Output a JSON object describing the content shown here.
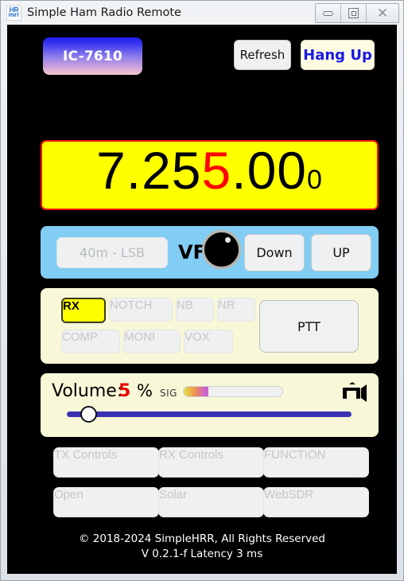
{
  "window": {
    "title": "Simple Ham Radio Remote",
    "icon_line1": "HR",
    "icon_line2": "RMT",
    "minimize_label": "",
    "maximize_label": "",
    "close_label": "✕"
  },
  "header": {
    "radio_model": "IC-7610",
    "refresh_label": "Refresh",
    "hangup_label": "Hang Up"
  },
  "frequency": {
    "part_black_1": "7.25",
    "part_red": "5",
    "part_black_2": ".00",
    "part_small": "0",
    "full_value": "7.255000",
    "bg_color": "#ffff00",
    "border_color": "#ff1010",
    "digit_color": "#000000",
    "highlight_color": "#ff0000"
  },
  "vfo": {
    "band_mode_label": "40m - LSB",
    "vfo_label": "VFO",
    "down_label": "Down",
    "up_label": "UP",
    "panel_color": "#82cdf4"
  },
  "controls": {
    "row1": [
      {
        "label": "RX",
        "state": "active"
      },
      {
        "label": "NOTCH",
        "state": "disabled"
      },
      {
        "label": "NB",
        "state": "disabled"
      },
      {
        "label": "NR",
        "state": "disabled"
      }
    ],
    "row2": [
      {
        "label": "COMP",
        "state": "disabled"
      },
      {
        "label": "MONI",
        "state": "disabled"
      },
      {
        "label": "VOX",
        "state": "disabled"
      }
    ],
    "ptt_label": "PTT",
    "panel_color": "#f8f8d8",
    "active_color": "#ffff00"
  },
  "volume": {
    "label": "Volume:",
    "value": "5",
    "unit": "%",
    "value_color": "#e80000",
    "sig_label": "SIG",
    "sig_percent": 25,
    "slider_percent": 5,
    "camera_icon": "video-camera-icon"
  },
  "nav": {
    "row1": [
      {
        "label": "TX Controls",
        "state": "disabled"
      },
      {
        "label": "RX Controls",
        "state": "disabled"
      },
      {
        "label": "FUNCTION",
        "state": "disabled"
      }
    ],
    "row2": [
      {
        "label": "Open",
        "state": "disabled"
      },
      {
        "label": "Solar",
        "state": "disabled"
      },
      {
        "label": "WebSDR",
        "state": "disabled"
      }
    ]
  },
  "footer": {
    "copyright": "© 2018-2024 SimpleHRR,  All Rights Reserved",
    "version_line": "V 0.2.1-f  Latency   3   ms"
  }
}
